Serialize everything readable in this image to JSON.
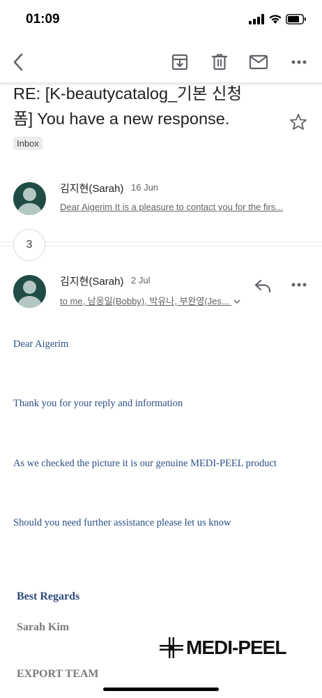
{
  "status_bar": {
    "time": "01:09"
  },
  "email": {
    "subject": "RE: [K-beautycatalog_기본 신청폼] You have a new response.",
    "label": "Inbox",
    "thread_count": "3",
    "message1": {
      "sender": "김지현(Sarah)",
      "date": "16 Jun",
      "snippet": "Dear Aigerim It is a pleasure to contact you for the firs..."
    },
    "message2": {
      "sender": "김지현(Sarah)",
      "date": "2 Jul",
      "recipients": "to me, 남웅일(Bobby), 박유나, 부완영(Jes..."
    },
    "body": {
      "line1": "Dear Aigerim",
      "line2": "Thank you for your reply and information",
      "line3": "As we checked the picture it is our genuine MEDI-PEEL product",
      "line4": "Should you need further assistance please let us know"
    },
    "signature": {
      "regards": "Best Regards",
      "name": "Sarah Kim",
      "team": "EXPORT TEAM",
      "logo_text": "MEDI-PEEL"
    }
  },
  "colors": {
    "avatar": "#1f4d45",
    "label_chevron": "#f4b400",
    "body_text": "#2c4f86",
    "regards_text": "#2c4a7a",
    "signature_gray": "#7a7a7a"
  },
  "icons": [
    "back-arrow-icon",
    "archive-icon",
    "trash-icon",
    "mail-icon",
    "more-icon",
    "star-icon",
    "reply-icon"
  ]
}
